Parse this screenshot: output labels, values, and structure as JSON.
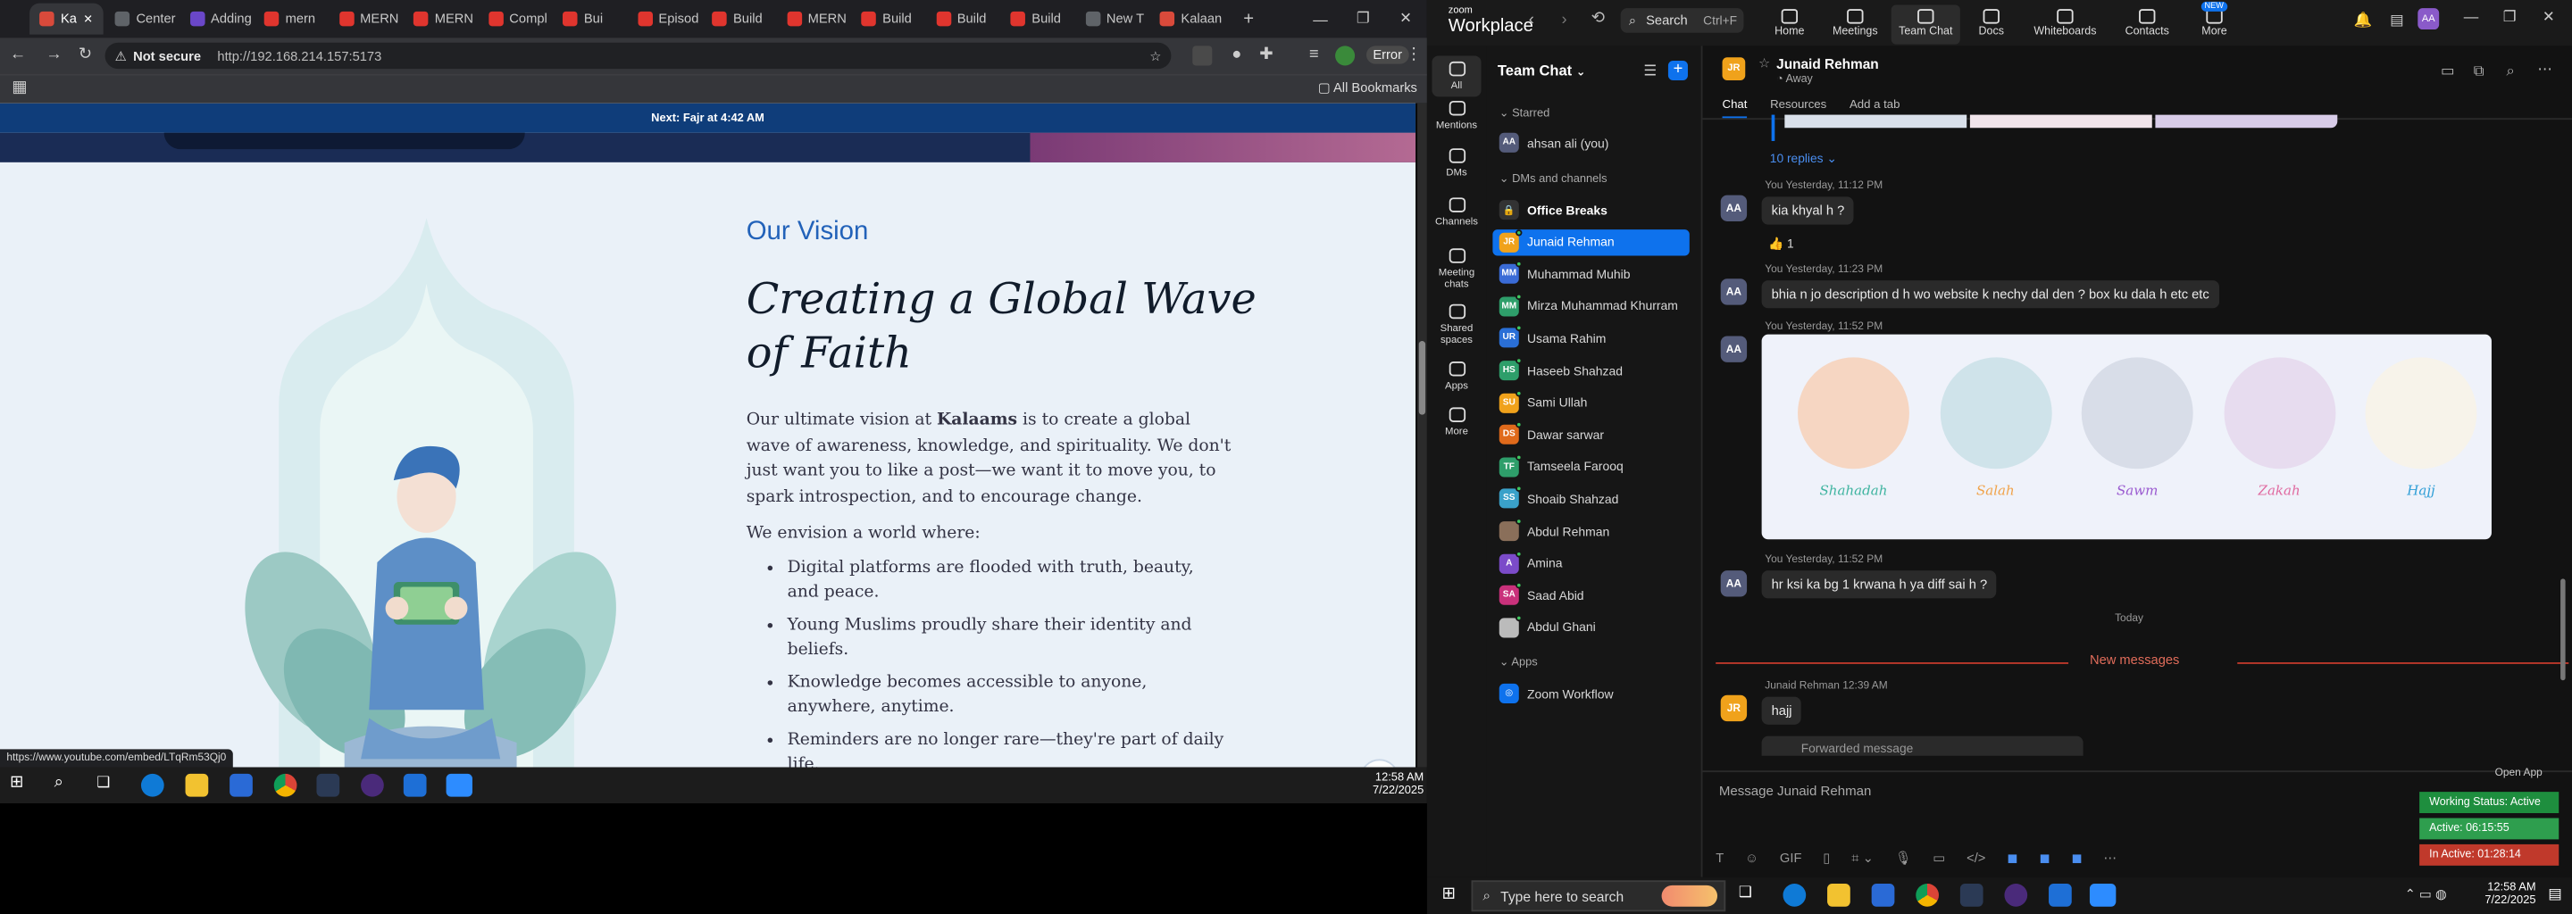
{
  "browser": {
    "tabs": [
      {
        "label": "Ka",
        "active": true
      },
      {
        "label": "Center"
      },
      {
        "label": "Adding"
      },
      {
        "label": "mern"
      },
      {
        "label": "MERN"
      },
      {
        "label": "MERN"
      },
      {
        "label": "Compl"
      },
      {
        "label": "Bui"
      },
      {
        "label": "Episod"
      },
      {
        "label": "Build"
      },
      {
        "label": "MERN"
      },
      {
        "label": "Build"
      },
      {
        "label": "Build"
      },
      {
        "label": "Build"
      },
      {
        "label": "New T"
      },
      {
        "label": "Kalaan"
      }
    ],
    "security_label": "Not secure",
    "url": "http://192.168.214.157:5173",
    "error_label": "Error",
    "all_bookmarks": "All Bookmarks",
    "status_url": "https://www.youtube.com/embed/LTqRm53Qj0"
  },
  "site": {
    "prayer_bar": "Next: Fajr at 4:42 AM",
    "vision_label": "Our Vision",
    "vision_title": "Creating a Global Wave of Faith",
    "body_pre": "Our ultimate vision at ",
    "body_brand": "Kalaams",
    "body_post": " is to create a global wave of awareness, knowledge, and spirituality. We don't just want you to like a post—we want it to move you, to spark introspection, and to encourage change.",
    "envision": "We envision a world where:",
    "list": [
      "Digital platforms are flooded with truth, beauty, and peace.",
      "Young Muslims proudly share their identity and beliefs.",
      "Knowledge becomes accessible to anyone, anywhere, anytime.",
      "Reminders are no longer rare—they're part of daily life."
    ]
  },
  "taskbar_left": {
    "time": "12:58 AM",
    "date": "7/22/2025"
  },
  "zoom": {
    "logo_top": "zoom",
    "logo_main": "Workplace",
    "search_label": "Search",
    "search_shortcut": "Ctrl+F",
    "nav": [
      {
        "label": "Home"
      },
      {
        "label": "Meetings"
      },
      {
        "label": "Team Chat",
        "active": true
      },
      {
        "label": "Docs"
      },
      {
        "label": "Whiteboards"
      },
      {
        "label": "Contacts"
      },
      {
        "label": "More",
        "badge": "NEW"
      }
    ],
    "rail": [
      "All",
      "Mentions",
      "DMs",
      "Channels",
      "Meeting chats",
      "Shared spaces",
      "Apps",
      "More"
    ],
    "sidebar_title": "Team Chat",
    "starred_label": "Starred",
    "starred_item": {
      "initials": "AA",
      "name": "ahsan ali (you)"
    },
    "dms_label": "DMs and channels",
    "channels": [
      {
        "initials": "",
        "name": "Office Breaks",
        "color": "#333333",
        "bold": true
      },
      {
        "initials": "JR",
        "name": "Junaid Rehman",
        "color": "#f0a21b",
        "selected": true
      },
      {
        "initials": "MM",
        "name": "Muhammad Muhib",
        "color": "#3a6bd6"
      },
      {
        "initials": "MM",
        "name": "Mirza Muhammad Khurram",
        "color": "#2e9e6a"
      },
      {
        "initials": "UR",
        "name": "Usama Rahim",
        "color": "#2a6fd6"
      },
      {
        "initials": "HS",
        "name": "Haseeb Shahzad",
        "color": "#2e9e6a"
      },
      {
        "initials": "SU",
        "name": "Sami Ullah",
        "color": "#f0a21b"
      },
      {
        "initials": "DS",
        "name": "Dawar sarwar",
        "color": "#e06a1b"
      },
      {
        "initials": "TF",
        "name": "Tamseela Farooq",
        "color": "#2e9e6a"
      },
      {
        "initials": "SS",
        "name": "Shoaib Shahzad",
        "color": "#3aa1c9"
      },
      {
        "initials": "",
        "name": "Abdul Rehman",
        "color": "#8a6f5a"
      },
      {
        "initials": "A",
        "name": "Amina",
        "color": "#7b4bc9"
      },
      {
        "initials": "SA",
        "name": "Saad Abid",
        "color": "#c9317b"
      },
      {
        "initials": "",
        "name": "Abdul Ghani",
        "color": "#bbbbbb"
      }
    ],
    "apps_label": "Apps",
    "app_item": "Zoom Workflow",
    "chat": {
      "name": "Junaid Rehman",
      "initials": "JR",
      "status": "Away",
      "tabs": [
        "Chat",
        "Resources",
        "Add a tab"
      ],
      "replies": "10 replies",
      "messages": [
        {
          "initials": "AA",
          "meta": "You Yesterday, 11:12 PM",
          "text": "kia khyal h ?"
        },
        {
          "initials": "AA",
          "meta": "You Yesterday, 11:23 PM",
          "text": "bhia n jo description d h wo website k nechy dal den ? box ku dala h etc etc"
        },
        {
          "initials": "AA",
          "meta": "You Yesterday, 11:52 PM",
          "text": ""
        },
        {
          "initials": "AA",
          "meta": "You Yesterday, 11:52 PM",
          "text": "hr ksi ka bg 1 krwana h ya diff sai h ?"
        }
      ],
      "reaction": "👍 1",
      "pillars": [
        {
          "label": "Shahadah",
          "color": "#3fb4a0",
          "bg": "#f6d6c2"
        },
        {
          "label": "Salah",
          "color": "#f0a34a",
          "bg": "#cfe3ea"
        },
        {
          "label": "Sawm",
          "color": "#9a5ad0",
          "bg": "#d8dde8"
        },
        {
          "label": "Zakah",
          "color": "#e06aa0",
          "bg": "#e7dcef"
        },
        {
          "label": "Hajj",
          "color": "#2e9ed6",
          "bg": "#f7f3ea"
        }
      ],
      "today": "Today",
      "new_messages": "New messages",
      "jr_meta": "Junaid Rehman 12:39 AM",
      "jr_text": "hajj",
      "forwarded": "Forwarded message",
      "composer_placeholder": "Message Junaid Rehman"
    },
    "open_app": "Open App",
    "status_boxes": [
      {
        "label": "Working Status: Active",
        "color": "#1e8e3e"
      },
      {
        "label": "Active: 06:15:55",
        "color": "#2e9e4e"
      },
      {
        "label": "In Active: 01:28:14",
        "color": "#c0392b"
      }
    ]
  },
  "taskbar_right": {
    "search_placeholder": "Type here to search",
    "time": "12:58 AM",
    "date": "7/22/2025"
  }
}
